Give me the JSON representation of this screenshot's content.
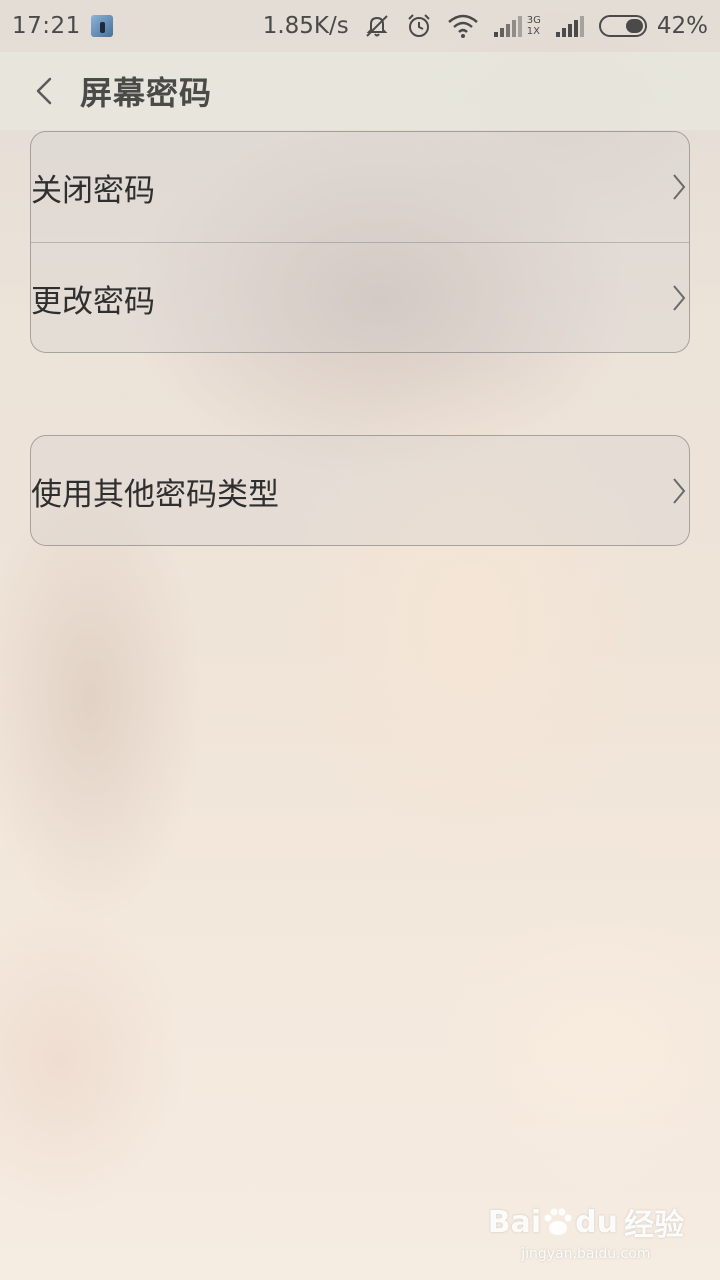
{
  "status_bar": {
    "time": "17:21",
    "net_speed": "1.85K/s",
    "network_top": "3G",
    "network_bottom": "1X",
    "battery_percent": "42%",
    "battery_level": 0.42,
    "icons": [
      "notification-thumbnail",
      "mute-icon",
      "alarm-icon",
      "wifi-icon",
      "signal-icon",
      "signal-icon",
      "battery-icon"
    ]
  },
  "header": {
    "back_icon": "chevron-left-icon",
    "title": "屏幕密码"
  },
  "groups": [
    {
      "items": [
        {
          "label": "关闭密码",
          "icon": "chevron-right-icon"
        },
        {
          "label": "更改密码",
          "icon": "chevron-right-icon"
        }
      ]
    },
    {
      "items": [
        {
          "label": "使用其他密码类型",
          "icon": "chevron-right-icon"
        }
      ]
    }
  ],
  "watermark": {
    "brand": "Bai",
    "brand_suffix": "du",
    "product": "经验",
    "url": "jingyan.baidu.com"
  },
  "colors": {
    "text_primary": "#2f2f2f",
    "title": "#4a4a48",
    "status": "#4a4a4a"
  }
}
